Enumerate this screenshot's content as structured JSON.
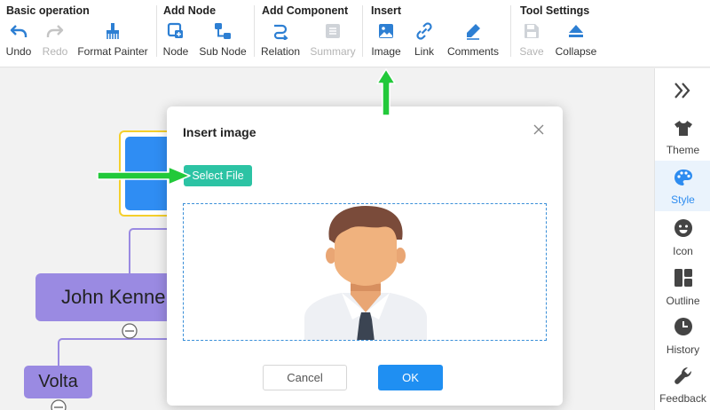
{
  "toolbar": {
    "groups": [
      {
        "title": "Basic operation",
        "tools": [
          {
            "label": "Undo",
            "icon": "undo-icon",
            "disabled": false
          },
          {
            "label": "Redo",
            "icon": "redo-icon",
            "disabled": true
          },
          {
            "label": "Format Painter",
            "icon": "format-painter-icon",
            "disabled": false
          }
        ]
      },
      {
        "title": "Add Node",
        "tools": [
          {
            "label": "Node",
            "icon": "node-icon",
            "disabled": false
          },
          {
            "label": "Sub Node",
            "icon": "sub-node-icon",
            "disabled": false
          }
        ]
      },
      {
        "title": "Add Component",
        "tools": [
          {
            "label": "Relation",
            "icon": "relation-icon",
            "disabled": false
          },
          {
            "label": "Summary",
            "icon": "summary-icon",
            "disabled": true
          }
        ]
      },
      {
        "title": "Insert",
        "tools": [
          {
            "label": "Image",
            "icon": "image-icon",
            "disabled": false
          },
          {
            "label": "Link",
            "icon": "link-icon",
            "disabled": false
          },
          {
            "label": "Comments",
            "icon": "comments-icon",
            "disabled": false
          }
        ]
      },
      {
        "title": "Tool Settings",
        "tools": [
          {
            "label": "Save",
            "icon": "save-icon",
            "disabled": true
          },
          {
            "label": "Collapse",
            "icon": "collapse-icon",
            "disabled": false
          }
        ]
      }
    ]
  },
  "right_panel": {
    "items": [
      {
        "label": "Theme",
        "icon": "tshirt-icon",
        "active": false
      },
      {
        "label": "Style",
        "icon": "palette-icon",
        "active": true
      },
      {
        "label": "Icon",
        "icon": "smiley-icon",
        "active": false
      },
      {
        "label": "Outline",
        "icon": "outline-icon",
        "active": false
      },
      {
        "label": "History",
        "icon": "clock-icon",
        "active": false
      },
      {
        "label": "Feedback",
        "icon": "wrench-icon",
        "active": false
      }
    ]
  },
  "canvas": {
    "nodes": [
      {
        "text": "John Kenne"
      },
      {
        "text": "Volta"
      }
    ]
  },
  "dialog": {
    "title": "Insert image",
    "select_file_label": "Select File",
    "cancel_label": "Cancel",
    "ok_label": "OK"
  },
  "colors": {
    "accent_blue": "#1f8ff2",
    "teal": "#2cc3a4",
    "node_purple": "#9a8ae2",
    "annotation_green": "#22c93a",
    "icon_blue": "#2d7fd3"
  }
}
